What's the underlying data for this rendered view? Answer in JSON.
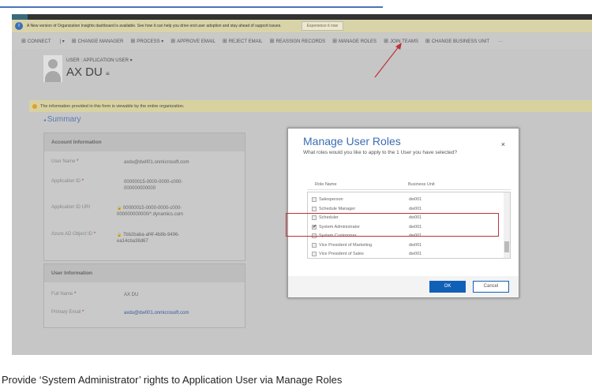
{
  "infobar": {
    "message": "A New version of Organization Insights dashboard is available. See how it can help you drive end user adoption and stay ahead of support issues.",
    "button": "Experience it now"
  },
  "toolbar": [
    {
      "icon": "connect-icon",
      "label": "CONNECT"
    },
    {
      "icon": "dropdown-icon",
      "label": "|  ▾"
    },
    {
      "icon": "manager-icon",
      "label": "CHANGE MANAGER"
    },
    {
      "icon": "process-icon",
      "label": "PROCESS ▾"
    },
    {
      "icon": "approve-email-icon",
      "label": "APPROVE EMAIL"
    },
    {
      "icon": "reject-email-icon",
      "label": "REJECT EMAIL"
    },
    {
      "icon": "reassign-icon",
      "label": "REASSIGN RECORDS"
    },
    {
      "icon": "manage-roles-icon",
      "label": "MANAGE ROLES"
    },
    {
      "icon": "join-teams-icon",
      "label": "JOIN TEAMS"
    },
    {
      "icon": "business-unit-icon",
      "label": "CHANGE BUSINESS UNIT"
    },
    {
      "icon": "more-icon",
      "label": "···"
    }
  ],
  "header": {
    "type": "USER : APPLICATION USER ▾",
    "name": "AX DU",
    "menu": "≡"
  },
  "notice": "The information provided in this form is viewable by the entire organization.",
  "summary": "Summary",
  "account": {
    "title": "Account Information",
    "fields": [
      {
        "label": "User Name",
        "value": "axdu@dw001.onmicrosoft.com",
        "lock": ""
      },
      {
        "label": "Application ID",
        "value": "00000015-0000-0000-c000-000000000000",
        "lock": ""
      },
      {
        "label": "Application ID URI",
        "value": "00000015-0000-0000-c000-000000000000/*.dynamics.com",
        "lock": "🔒"
      },
      {
        "label": "Azure AD Object ID",
        "value": "7bb2baba-af4f-4b8b-9496-ea14cba38d67",
        "lock": "🔒"
      }
    ]
  },
  "user_info": {
    "title": "User Information",
    "fields": [
      {
        "label": "Full Name",
        "value": "AX DU"
      },
      {
        "label": "Primary Email",
        "value": "axdu@dw001.onmicrosoft.com"
      }
    ]
  },
  "dialog": {
    "title": "Manage User Roles",
    "subtitle": "What roles would you like to apply to the 1 User you have selected?",
    "close": "×",
    "columns": [
      "Role Name",
      "Business Unit"
    ],
    "rows": [
      {
        "name": "Salesperson",
        "unit": "dw001",
        "checked": false
      },
      {
        "name": "Schedule Manager",
        "unit": "dw001",
        "checked": false
      },
      {
        "name": "Scheduler",
        "unit": "dw001",
        "checked": false
      },
      {
        "name": "System Administrator",
        "unit": "dw001",
        "checked": true
      },
      {
        "name": "System Customizer",
        "unit": "dw001",
        "checked": false
      },
      {
        "name": "Vice President of Marketing",
        "unit": "dw001",
        "checked": false
      },
      {
        "name": "Vice President of Sales",
        "unit": "dw001",
        "checked": false
      }
    ],
    "ok": "OK",
    "cancel": "Cancel"
  },
  "caption": "Provide ‘System Administrator’ rights to Application User via Manage Roles",
  "colors": {
    "accent": "#3b6db3",
    "ok_button": "#1160b7",
    "highlight": "#c0303a"
  }
}
